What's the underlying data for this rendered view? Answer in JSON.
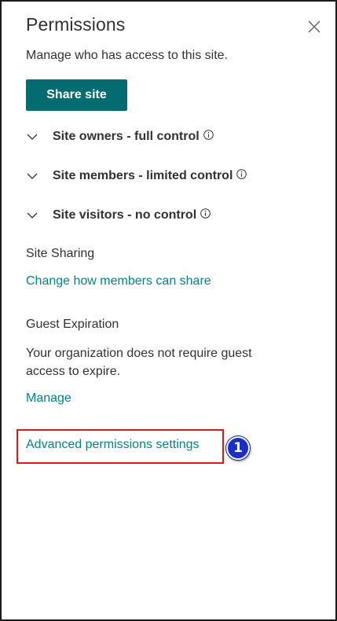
{
  "panel": {
    "title": "Permissions",
    "subtitle": "Manage who has access to this site.",
    "close_icon": "close-icon",
    "share_button": "Share site"
  },
  "groups": [
    {
      "label": "Site owners - full control",
      "icon": "chevron-down-icon",
      "info_icon": "info-icon"
    },
    {
      "label": "Site members - limited control",
      "icon": "chevron-down-icon",
      "info_icon": "info-icon"
    },
    {
      "label": "Site visitors - no control",
      "icon": "chevron-down-icon",
      "info_icon": "info-icon"
    }
  ],
  "site_sharing": {
    "heading": "Site Sharing",
    "link": "Change how members can share"
  },
  "guest_expiration": {
    "heading": "Guest Expiration",
    "description": "Your organization does not require guest access to expire.",
    "link": "Manage"
  },
  "advanced": {
    "link": "Advanced permissions settings",
    "step_badge": "1"
  },
  "colors": {
    "accent": "#036c70",
    "link": "#038387",
    "highlight": "#e0141e",
    "badge": "#1a2fc9"
  }
}
